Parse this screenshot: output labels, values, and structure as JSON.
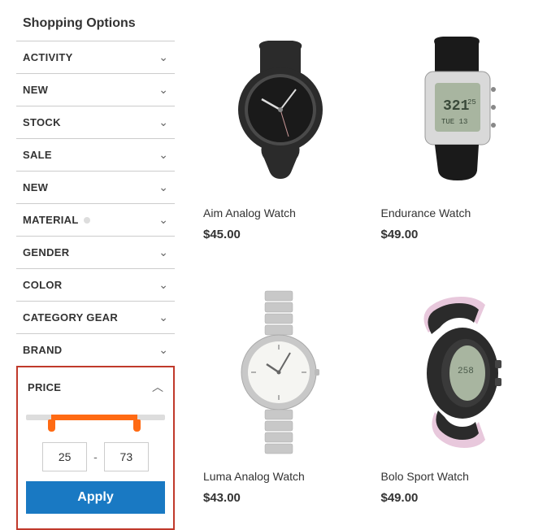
{
  "sidebar": {
    "title": "Shopping Options",
    "filters": [
      {
        "label": "ACTIVITY",
        "expanded": false
      },
      {
        "label": "NEW",
        "expanded": false
      },
      {
        "label": "STOCK",
        "expanded": false
      },
      {
        "label": "SALE",
        "expanded": false
      },
      {
        "label": "NEW",
        "expanded": false
      },
      {
        "label": "MATERIAL",
        "expanded": false,
        "dot": true
      },
      {
        "label": "GENDER",
        "expanded": false
      },
      {
        "label": "COLOR",
        "expanded": false
      },
      {
        "label": "CATEGORY GEAR",
        "expanded": false
      },
      {
        "label": "BRAND",
        "expanded": false
      }
    ],
    "price": {
      "label": "PRICE",
      "expanded": true,
      "min": "25",
      "max": "73",
      "apply": "Apply"
    }
  },
  "products": [
    {
      "name": "Aim Analog Watch",
      "price": "$45.00"
    },
    {
      "name": "Endurance Watch",
      "price": "$49.00"
    },
    {
      "name": "Luma Analog Watch",
      "price": "$43.00"
    },
    {
      "name": "Bolo Sport Watch",
      "price": "$49.00"
    }
  ]
}
